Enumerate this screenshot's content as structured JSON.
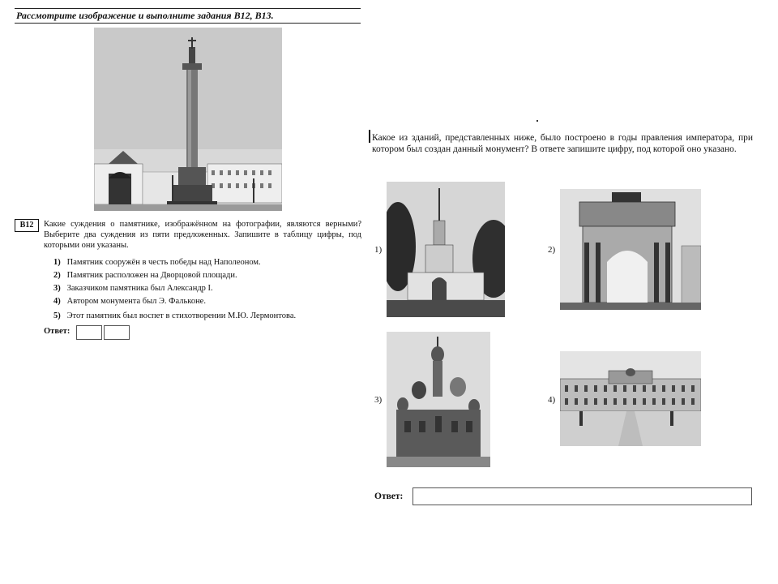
{
  "task1": {
    "header": "Рассмотрите изображение и выполните задания В12, В13.",
    "badge": "В12",
    "question": "Какие суждения о памятнике, изображённом на фотографии, являются верными? Выберите два суждения из пяти предложенных. Запишите в таблицу цифры, под которыми они указаны.",
    "options": [
      {
        "num": "1)",
        "text": "Памятник сооружён в честь победы над Наполеоном."
      },
      {
        "num": "2)",
        "text": "Памятник расположен на Дворцовой площади."
      },
      {
        "num": "3)",
        "text": "Заказчиком памятника был Александр I."
      },
      {
        "num": "4)",
        "text": "Автором монумента был Э. Фальконе."
      },
      {
        "num": "5)",
        "text": "Этот памятник был воспет в стихотворении М.Ю. Лермонтова."
      }
    ],
    "answer_label": "Ответ:"
  },
  "task2": {
    "question": "Какое из зданий, представленных ниже, было построено в годы правления императора, при котором был создан данный монумент? В ответе запишите цифру, под которой оно указано.",
    "options": [
      "1)",
      "2)",
      "3)",
      "4)"
    ],
    "answer_label": "Ответ:"
  }
}
